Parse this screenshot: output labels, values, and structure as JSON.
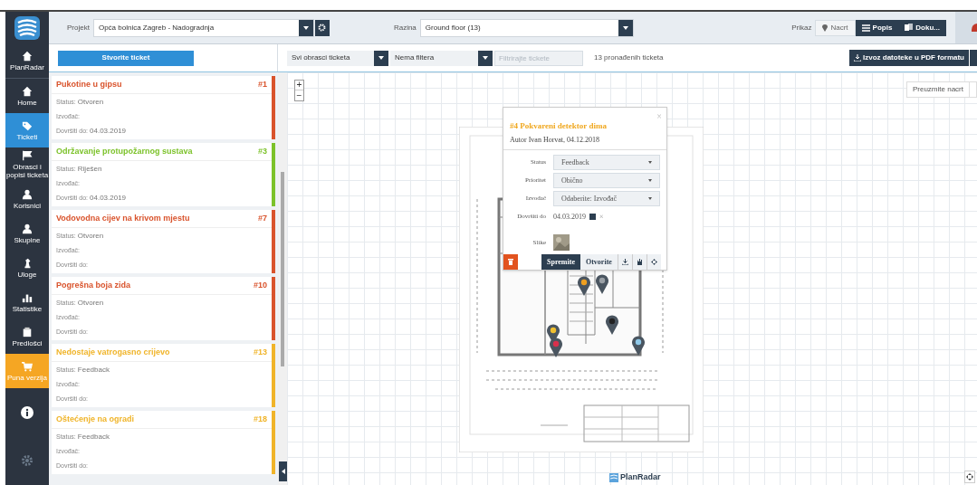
{
  "header": {
    "project_label": "Projekt",
    "project": "Opća bolnica Zagreb - Nadogradnja",
    "level_label": "Razina",
    "level": "Ground floor (13)",
    "view_label": "Prikaz",
    "views": [
      {
        "label": "Nacrt",
        "selected": true
      },
      {
        "label": "Popis",
        "selected": false
      },
      {
        "label": "Doku...",
        "selected": false
      }
    ]
  },
  "sidebar": {
    "items": [
      {
        "label": "PlanRadar",
        "kind": "nav",
        "selected": false
      },
      {
        "label": "Home",
        "kind": "nav",
        "selected": false
      },
      {
        "label": "Ticketi",
        "kind": "nav",
        "selected": true
      },
      {
        "label": "Obrasci i popisi ticketa",
        "kind": "nav",
        "selected": false
      },
      {
        "label": "Korisnici",
        "kind": "nav",
        "selected": false
      },
      {
        "label": "Skupine",
        "kind": "nav",
        "selected": false
      },
      {
        "label": "Uloge",
        "kind": "nav",
        "selected": false
      },
      {
        "label": "Statistike",
        "kind": "nav",
        "selected": false
      },
      {
        "label": "Predlošci",
        "kind": "nav",
        "selected": false
      },
      {
        "label": "Puna verzija",
        "kind": "upgrade",
        "selected": false
      }
    ]
  },
  "toolbar": {
    "create": "Stvorite ticket",
    "form_filter": "Svi obrasci ticketa",
    "filter": "Nema filtera",
    "search_placeholder": "Filtrirajte tickete",
    "count": "13 pronađenih ticketa",
    "export": "Izvoz datoteke u PDF formatu"
  },
  "tickets": [
    {
      "title": "Pukotine u gipsu",
      "number": "#1",
      "color": "#d9532c",
      "fields": [
        {
          "label": "Status:",
          "value": "Otvoren"
        },
        {
          "label": "Izvođač:"
        },
        {
          "label": "Dovršiti do:",
          "value": "04.03.2019"
        }
      ]
    },
    {
      "title": "Održavanje protupožarnog sustava",
      "number": "#3",
      "color": "#7cc22a",
      "fields": [
        {
          "label": "Status:",
          "value": "Riješen"
        },
        {
          "label": "Izvođač:"
        },
        {
          "label": "Dovršiti do:",
          "value": "04.03.2019"
        }
      ]
    },
    {
      "title": "Vodovodna cijev na krivom mjestu",
      "number": "#7",
      "color": "#d9532c",
      "fields": [
        {
          "label": "Status:",
          "value": "Otvoren"
        },
        {
          "label": "Izvođač:"
        },
        {
          "label": "Dovršiti do:"
        }
      ]
    },
    {
      "title": "Pogrešna boja zida",
      "number": "#10",
      "color": "#d9532c",
      "fields": [
        {
          "label": "Status:",
          "value": "Otvoren"
        },
        {
          "label": "Izvođač:"
        },
        {
          "label": "Dovršiti do:"
        }
      ]
    },
    {
      "title": "Nedostaje vatrogasno crijevo",
      "number": "#13",
      "color": "#f0b429",
      "fields": [
        {
          "label": "Status:",
          "value": "Feedback"
        },
        {
          "label": "Izvođač:"
        },
        {
          "label": "Dovršiti do:"
        }
      ]
    },
    {
      "title": "Oštećenje na ogradi",
      "number": "#18",
      "color": "#f0b429",
      "fields": [
        {
          "label": "Status:",
          "value": "Feedback"
        },
        {
          "label": "Izvođač:"
        },
        {
          "label": "Dovršiti do:"
        }
      ]
    }
  ],
  "map": {
    "zoom_in": "+",
    "zoom_out": "−",
    "download": "Preuzmite nacrt",
    "brand": "PlanRadar",
    "pins": [
      {
        "color": "#f0a020"
      },
      {
        "color": "#9aa0a6"
      },
      {
        "color": "#f0c030"
      },
      {
        "color": "#d9304c"
      },
      {
        "color": "#222222"
      },
      {
        "color": "#8fc8e8"
      }
    ]
  },
  "popup": {
    "title": "#4 Pokvareni detektor dima",
    "author": "Autor Ivan Horvat, 04.12.2018",
    "close": "×",
    "fields": [
      {
        "label": "Status",
        "kind": "select",
        "value": "Feedback"
      },
      {
        "label": "Prioritet",
        "kind": "select",
        "value": "Obično"
      },
      {
        "label": "Izvođač",
        "kind": "select",
        "value": "Odaberite: Izvođač"
      },
      {
        "label": "Dovršiti do",
        "kind": "date",
        "value": "04.03.2019",
        "clear": "×"
      },
      {
        "label": "Slike"
      }
    ],
    "save": "Spremite",
    "open": "Otvorite"
  }
}
